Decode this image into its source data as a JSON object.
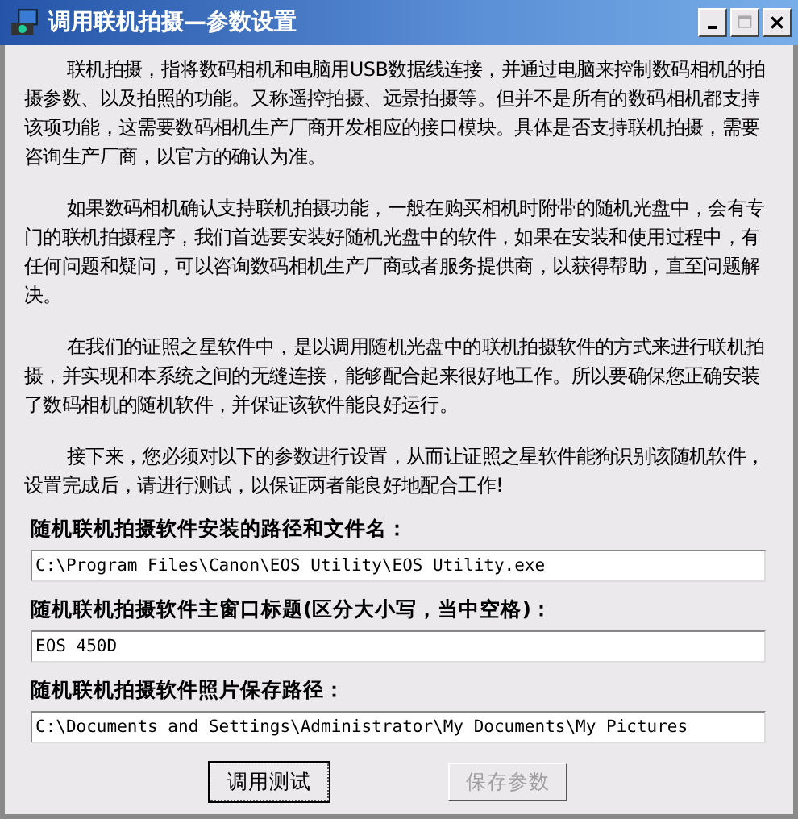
{
  "window": {
    "title": "调用联机拍摄—参数设置",
    "controls": [
      {
        "kind": "minimize"
      },
      {
        "kind": "maximize",
        "disabled": true
      },
      {
        "kind": "close"
      }
    ]
  },
  "paragraphs": [
    "联机拍摄，指将数码相机和电脑用USB数据线连接，并通过电脑来控制数码相机的拍摄参数、以及拍照的功能。又称遥控拍摄、远景拍摄等。但并不是所有的数码相机都支持该项功能，这需要数码相机生产厂商开发相应的接口模块。具体是否支持联机拍摄，需要咨询生产厂商，以官方的确认为准。",
    "如果数码相机确认支持联机拍摄功能，一般在购买相机时附带的随机光盘中，会有专门的联机拍摄程序，我们首选要安装好随机光盘中的软件，如果在安装和使用过程中，有任何问题和疑问，可以咨询数码相机生产厂商或者服务提供商，以获得帮助，直至问题解决。",
    "在我们的证照之星软件中，是以调用随机光盘中的联机拍摄软件的方式来进行联机拍摄，并实现和本系统之间的无缝连接，能够配合起来很好地工作。所以要确保您正确安装了数码相机的随机软件，并保证该软件能良好运行。",
    "接下来，您必须对以下的参数进行设置，从而让证照之星软件能狗识别该随机软件，设置完成后，请进行测试，以保证两者能良好地配合工作!"
  ],
  "fields": [
    {
      "label": "随机联机拍摄软件安装的路径和文件名：",
      "value": "C:\\Program Files\\Canon\\EOS Utility\\EOS Utility.exe"
    },
    {
      "label": "随机联机拍摄软件主窗口标题(区分大小写，当中空格)：",
      "value": "EOS 450D"
    },
    {
      "label": "随机联机拍摄软件照片保存路径：",
      "value": "C:\\Documents and Settings\\Administrator\\My Documents\\My Pictures"
    }
  ],
  "buttons": [
    {
      "label": "调用测试",
      "disabled": false,
      "focused": true
    },
    {
      "label": "保存参数",
      "disabled": true,
      "focused": false
    }
  ]
}
